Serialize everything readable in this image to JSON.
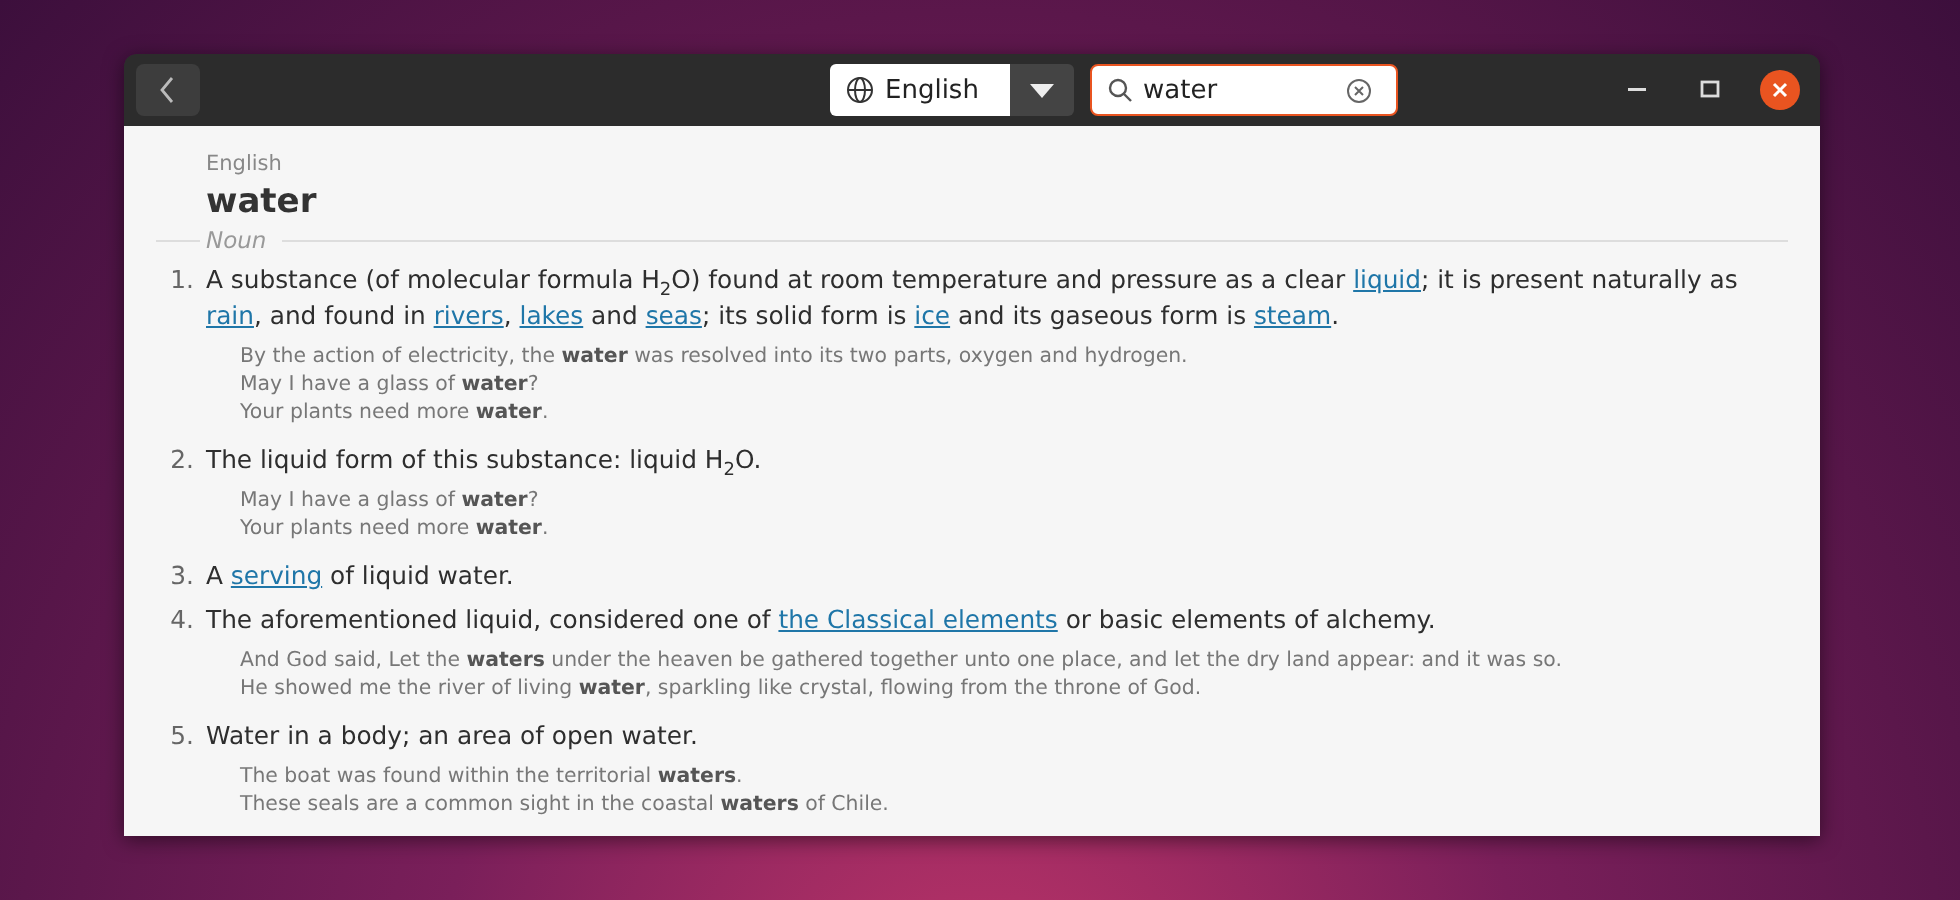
{
  "header": {
    "language": "English",
    "search": {
      "value": "water"
    }
  },
  "entry": {
    "language": "English",
    "word": "water",
    "part_of_speech": "Noun",
    "definitions": [
      {
        "number": "1.",
        "parts": [
          {
            "kind": "text",
            "text": "A substance (of molecular formula H$_{2}$O) found at room temperature and pressure as a clear "
          },
          {
            "kind": "link",
            "text": "liquid"
          },
          {
            "kind": "text",
            "text": "; it is present naturally as "
          },
          {
            "kind": "link",
            "text": "rain"
          },
          {
            "kind": "text",
            "text": ", and found in "
          },
          {
            "kind": "link",
            "text": "rivers"
          },
          {
            "kind": "text",
            "text": ", "
          },
          {
            "kind": "link",
            "text": "lakes"
          },
          {
            "kind": "text",
            "text": " and "
          },
          {
            "kind": "link",
            "text": "seas"
          },
          {
            "kind": "text",
            "text": "; its solid form is "
          },
          {
            "kind": "link",
            "text": "ice"
          },
          {
            "kind": "text",
            "text": " and its gaseous form is "
          },
          {
            "kind": "link",
            "text": "steam"
          },
          {
            "kind": "text",
            "text": "."
          }
        ],
        "examples": [
          "By the action of electricity, the **water** was resolved into its two parts, oxygen and hydrogen.",
          "May I have a glass of **water**?",
          "Your plants need more **water**."
        ]
      },
      {
        "number": "2.",
        "parts": [
          {
            "kind": "text",
            "text": "The liquid form of this substance: liquid H$_{2}$O."
          }
        ],
        "examples": [
          "May I have a glass of **water**?",
          "Your plants need more **water**."
        ]
      },
      {
        "number": "3.",
        "parts": [
          {
            "kind": "text",
            "text": "A "
          },
          {
            "kind": "link",
            "text": "serving"
          },
          {
            "kind": "text",
            "text": " of liquid water."
          }
        ]
      },
      {
        "number": "4.",
        "parts": [
          {
            "kind": "text",
            "text": "The aforementioned liquid, considered one of "
          },
          {
            "kind": "link",
            "text": "the Classical elements"
          },
          {
            "kind": "text",
            "text": " or basic elements of alchemy."
          }
        ],
        "examples": [
          "And God said, Let the **waters** under the heaven be gathered together unto one place, and let the dry land appear: and it was so.",
          "He showed me the river of living **water**, sparkling like crystal, flowing from the throne of God."
        ]
      },
      {
        "number": "5.",
        "parts": [
          {
            "kind": "text",
            "text": "Water in a body; an area of open water."
          }
        ],
        "examples": [
          "The boat was found within the territorial **waters**.",
          "These seals are a common sight in the coastal **waters** of Chile."
        ]
      }
    ]
  }
}
